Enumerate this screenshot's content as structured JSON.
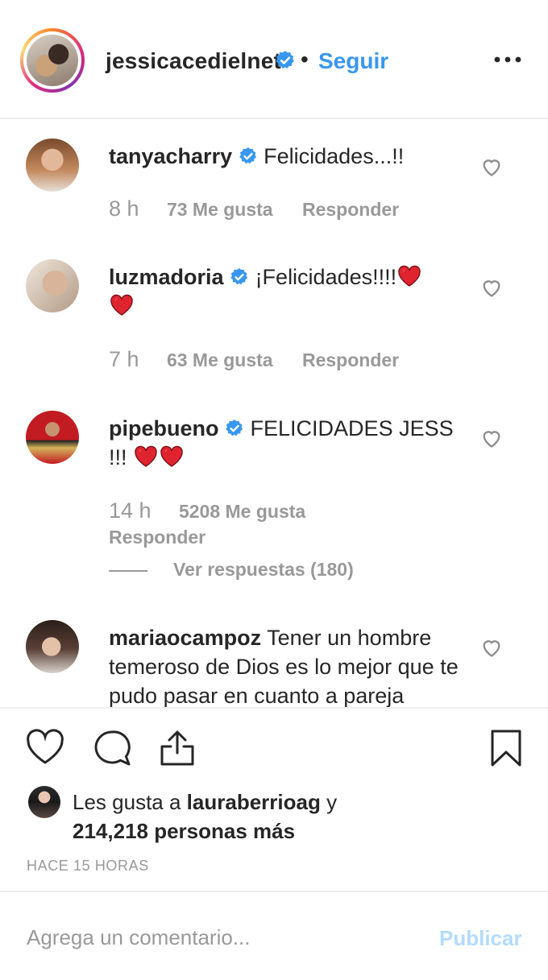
{
  "post": {
    "author": "jessicacedielnet",
    "separator": "•",
    "follow_label": "Seguir",
    "more_icon": "more-dots-icon"
  },
  "comments": [
    {
      "user": "tanyacharry",
      "verified": true,
      "text": "Felicidades...!!",
      "time": "8 h",
      "likes": "73 Me gusta",
      "reply": "Responder"
    },
    {
      "user": "luzmadoria",
      "verified": true,
      "text": "¡Felicidades!!!!",
      "time": "7 h",
      "likes": "63 Me gusta",
      "reply": "Responder"
    },
    {
      "user": "pipebueno",
      "verified": true,
      "text_line1": "FELICIDADES JESS",
      "text_line2": "!!!",
      "time": "14 h",
      "likes": "5208 Me gusta",
      "reply": "Responder",
      "view_replies": "Ver respuestas (180)"
    },
    {
      "user": "mariaocampoz",
      "verified": false,
      "text": "Tener un hombre temeroso de Dios es lo mejor que te pudo pasar en cuanto a pareja"
    }
  ],
  "likes_summary": {
    "prefix": "Les gusta a",
    "liker": "lauraberrioag",
    "connector": "y",
    "others": "214,218 personas más"
  },
  "timestamp": "HACE 15 HORAS",
  "comment_box": {
    "placeholder": "Agrega un comentario...",
    "publish_label": "Publicar"
  },
  "colors": {
    "link": "#3897f0",
    "verified": "#3897f0",
    "muted": "#999999",
    "heart": "#e0242f",
    "publish_disabled": "#b3dbff"
  }
}
